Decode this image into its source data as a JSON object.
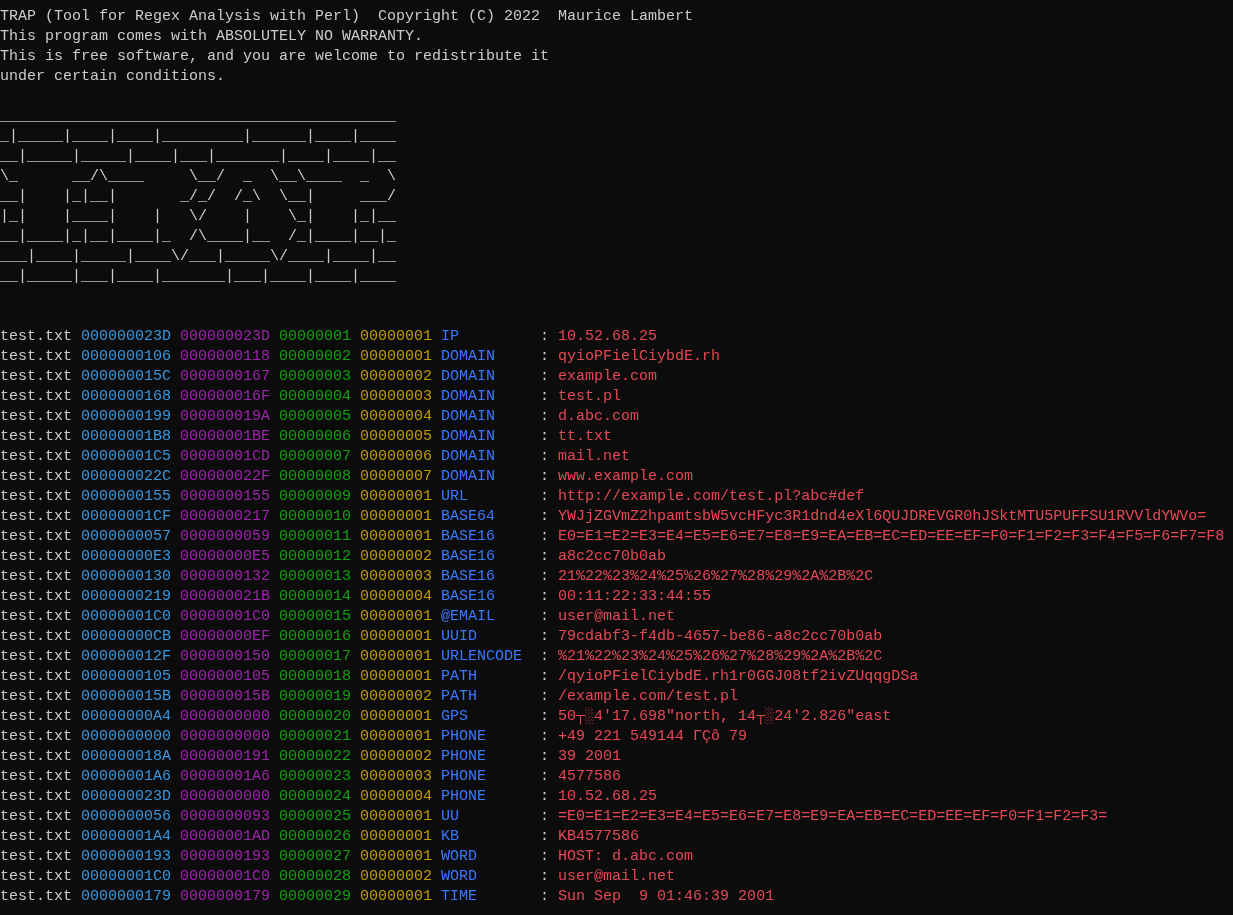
{
  "header_lines": [
    "TRAP (Tool for Regex Analysis with Perl)  Copyright (C) 2022  Maurice Lambert",
    "This program comes with ABSOLUTELY NO WARRANTY.",
    "This is free software, and you are welcome to redistribute it",
    "under certain conditions."
  ],
  "ascii_art": [
    "____________________________________________",
    "_|_____|____|____|_________|______|____|____",
    "__|_____|_____|____|___|_______|____|____|__",
    "\\_      __/\\____     \\__/  _  \\__\\____  _  \\",
    "__|    |_|__|       _/_/  /_\\  \\__|     ___/",
    "|_|    |____|    |   \\/    |    \\_|    |_|__",
    "__|____|_|__|____|_  /\\____|__  /_|____|__|_",
    "___|____|_____|____\\/___|_____\\/____|____|__",
    "__|_____|___|____|_______|___|____|____|____"
  ],
  "results": [
    {
      "file": "test.txt",
      "start": "000000023D",
      "end": "000000023D",
      "match": "00000001",
      "index": "00000001",
      "type": "IP",
      "separator": ":",
      "value": "10.52.68.25"
    },
    {
      "file": "test.txt",
      "start": "0000000106",
      "end": "0000000118",
      "match": "00000002",
      "index": "00000001",
      "type": "DOMAIN",
      "separator": ":",
      "value": "qyioPFielCiybdE.rh"
    },
    {
      "file": "test.txt",
      "start": "000000015C",
      "end": "0000000167",
      "match": "00000003",
      "index": "00000002",
      "type": "DOMAIN",
      "separator": ":",
      "value": "example.com"
    },
    {
      "file": "test.txt",
      "start": "0000000168",
      "end": "000000016F",
      "match": "00000004",
      "index": "00000003",
      "type": "DOMAIN",
      "separator": ":",
      "value": "test.pl"
    },
    {
      "file": "test.txt",
      "start": "0000000199",
      "end": "000000019A",
      "match": "00000005",
      "index": "00000004",
      "type": "DOMAIN",
      "separator": ":",
      "value": "d.abc.com"
    },
    {
      "file": "test.txt",
      "start": "00000001B8",
      "end": "00000001BE",
      "match": "00000006",
      "index": "00000005",
      "type": "DOMAIN",
      "separator": ":",
      "value": "tt.txt"
    },
    {
      "file": "test.txt",
      "start": "00000001C5",
      "end": "00000001CD",
      "match": "00000007",
      "index": "00000006",
      "type": "DOMAIN",
      "separator": ":",
      "value": "mail.net"
    },
    {
      "file": "test.txt",
      "start": "000000022C",
      "end": "000000022F",
      "match": "00000008",
      "index": "00000007",
      "type": "DOMAIN",
      "separator": ":",
      "value": "www.example.com"
    },
    {
      "file": "test.txt",
      "start": "0000000155",
      "end": "0000000155",
      "match": "00000009",
      "index": "00000001",
      "type": "URL",
      "separator": ":",
      "value": "http://example.com/test.pl?abc#def"
    },
    {
      "file": "test.txt",
      "start": "00000001CF",
      "end": "0000000217",
      "match": "00000010",
      "index": "00000001",
      "type": "BASE64",
      "separator": ":",
      "value": "YWJjZGVmZ2hpamtsbW5vcHFyc3R1dnd4eXl6QUJDREVGR0hJSktMTU5PUFFSU1RVVldYWVo="
    },
    {
      "file": "test.txt",
      "start": "0000000057",
      "end": "0000000059",
      "match": "00000011",
      "index": "00000001",
      "type": "BASE16",
      "separator": ":",
      "value": "E0=E1=E2=E3=E4=E5=E6=E7=E8=E9=EA=EB=EC=ED=EE=EF=F0=F1=F2=F3=F4=F5=F6=F7=F8"
    },
    {
      "file": "test.txt",
      "start": "00000000E3",
      "end": "00000000E5",
      "match": "00000012",
      "index": "00000002",
      "type": "BASE16",
      "separator": ":",
      "value": "a8c2cc70b0ab"
    },
    {
      "file": "test.txt",
      "start": "0000000130",
      "end": "0000000132",
      "match": "00000013",
      "index": "00000003",
      "type": "BASE16",
      "separator": ":",
      "value": "21%22%23%24%25%26%27%28%29%2A%2B%2C"
    },
    {
      "file": "test.txt",
      "start": "0000000219",
      "end": "000000021B",
      "match": "00000014",
      "index": "00000004",
      "type": "BASE16",
      "separator": ":",
      "value": "00:11:22:33:44:55"
    },
    {
      "file": "test.txt",
      "start": "00000001C0",
      "end": "00000001C0",
      "match": "00000015",
      "index": "00000001",
      "type": "@EMAIL",
      "separator": ":",
      "value": "user@mail.net"
    },
    {
      "file": "test.txt",
      "start": "00000000CB",
      "end": "00000000EF",
      "match": "00000016",
      "index": "00000001",
      "type": "UUID",
      "separator": ":",
      "value": "79cdabf3-f4db-4657-be86-a8c2cc70b0ab"
    },
    {
      "file": "test.txt",
      "start": "000000012F",
      "end": "0000000150",
      "match": "00000017",
      "index": "00000001",
      "type": "URLENCODE",
      "separator": ":",
      "value": "%21%22%23%24%25%26%27%28%29%2A%2B%2C"
    },
    {
      "file": "test.txt",
      "start": "0000000105",
      "end": "0000000105",
      "match": "00000018",
      "index": "00000001",
      "type": "PATH",
      "separator": ":",
      "value": "/qyioPFielCiybdE.rh1r0GGJ08tf2ivZUqqgDSa"
    },
    {
      "file": "test.txt",
      "start": "000000015B",
      "end": "000000015B",
      "match": "00000019",
      "index": "00000002",
      "type": "PATH",
      "separator": ":",
      "value": "/example.com/test.pl"
    },
    {
      "file": "test.txt",
      "start": "00000000A4",
      "end": "0000000000",
      "match": "00000020",
      "index": "00000001",
      "type": "GPS",
      "separator": ":",
      "value": "50┬░4'17.698\"north, 14┬░24'2.826\"east"
    },
    {
      "file": "test.txt",
      "start": "0000000000",
      "end": "0000000000",
      "match": "00000021",
      "index": "00000001",
      "type": "PHONE",
      "separator": ":",
      "value": "+49 221 549144 ΓÇô 79"
    },
    {
      "file": "test.txt",
      "start": "000000018A",
      "end": "0000000191",
      "match": "00000022",
      "index": "00000002",
      "type": "PHONE",
      "separator": ":",
      "value": "39 2001"
    },
    {
      "file": "test.txt",
      "start": "00000001A6",
      "end": "00000001A6",
      "match": "00000023",
      "index": "00000003",
      "type": "PHONE",
      "separator": ":",
      "value": "4577586"
    },
    {
      "file": "test.txt",
      "start": "000000023D",
      "end": "0000000000",
      "match": "00000024",
      "index": "00000004",
      "type": "PHONE",
      "separator": ":",
      "value": "10.52.68.25"
    },
    {
      "file": "test.txt",
      "start": "0000000056",
      "end": "0000000093",
      "match": "00000025",
      "index": "00000001",
      "type": "UU",
      "separator": ":",
      "value": "=E0=E1=E2=E3=E4=E5=E6=E7=E8=E9=EA=EB=EC=ED=EE=EF=F0=F1=F2=F3="
    },
    {
      "file": "test.txt",
      "start": "00000001A4",
      "end": "00000001AD",
      "match": "00000026",
      "index": "00000001",
      "type": "KB",
      "separator": ":",
      "value": "KB4577586"
    },
    {
      "file": "test.txt",
      "start": "0000000193",
      "end": "0000000193",
      "match": "00000027",
      "index": "00000001",
      "type": "WORD",
      "separator": ":",
      "value": "HOST: d.abc.com"
    },
    {
      "file": "test.txt",
      "start": "00000001C0",
      "end": "00000001C0",
      "match": "00000028",
      "index": "00000002",
      "type": "WORD",
      "separator": ":",
      "value": "user@mail.net"
    },
    {
      "file": "test.txt",
      "start": "0000000179",
      "end": "0000000179",
      "match": "00000029",
      "index": "00000001",
      "type": "TIME",
      "separator": ":",
      "value": "Sun Sep  9 01:46:39 2001"
    }
  ]
}
